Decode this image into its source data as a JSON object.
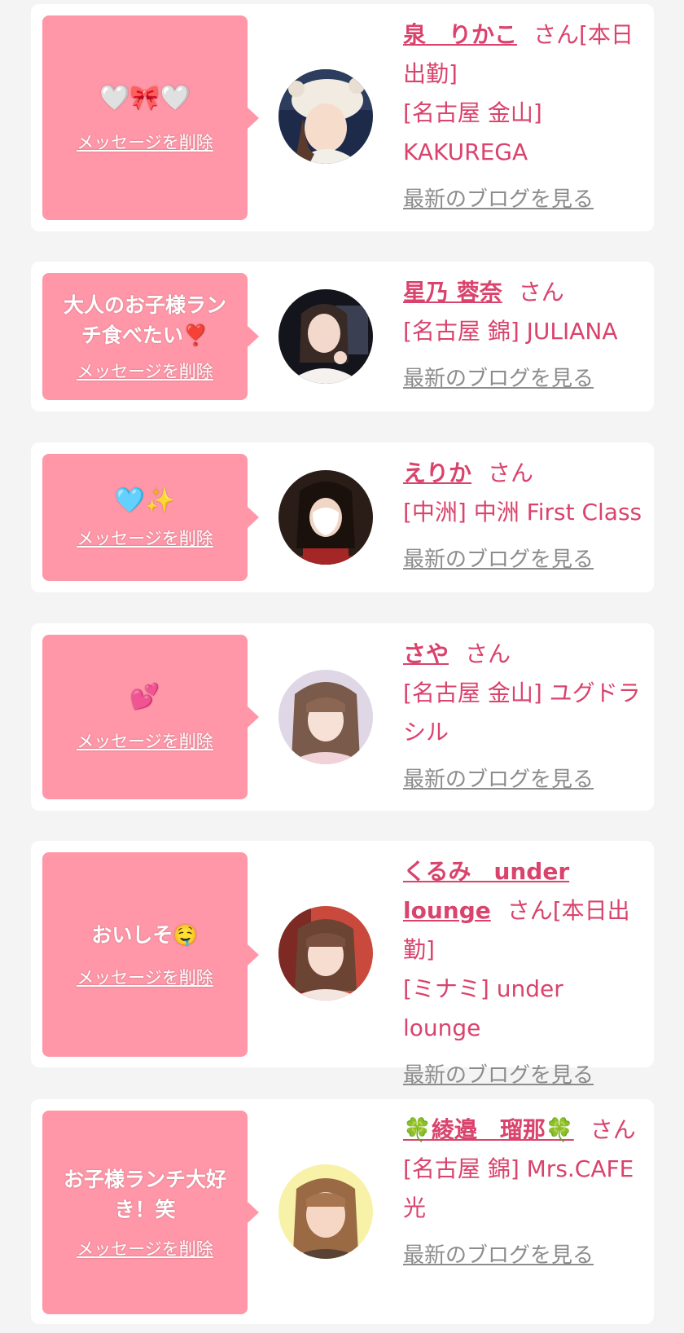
{
  "colors": {
    "background": "#f4f4f4",
    "card": "#ffffff",
    "bubble": "#ff97a8",
    "accent_text": "#d9436c",
    "link_gray": "#8c8c8c"
  },
  "cards": [
    {
      "message": "🤍🎀🤍",
      "delete_label": "メッセージを削除",
      "cast_name": "泉　りかこ",
      "cast_suffix": "さん[本日出勤]",
      "shop": "[名古屋 金山] KAKUREGA",
      "blog_label": "最新のブログを見る",
      "avatar": "avatar-photo"
    },
    {
      "message": "大人のお子様ランチ食べたい❣️",
      "delete_label": "メッセージを削除",
      "cast_name": "星乃 蓉奈",
      "cast_suffix": "さん",
      "shop": "[名古屋 錦] JULIANA",
      "blog_label": "最新のブログを見る",
      "avatar": "avatar-photo"
    },
    {
      "message": "🩵✨",
      "delete_label": "メッセージを削除",
      "cast_name": "えりか",
      "cast_suffix": "さん",
      "shop": "[中洲] 中洲 First Class",
      "blog_label": "最新のブログを見る",
      "avatar": "avatar-photo"
    },
    {
      "message": "💕",
      "delete_label": "メッセージを削除",
      "cast_name": "さや",
      "cast_suffix": "さん",
      "shop": "[名古屋 金山] ユグドラシル",
      "blog_label": "最新のブログを見る",
      "avatar": "avatar-photo"
    },
    {
      "message": "おいしそ🤤",
      "delete_label": "メッセージを削除",
      "cast_name": "くるみ　under lounge",
      "cast_suffix": "さん[本日出勤]",
      "shop": "[ミナミ] under lounge",
      "blog_label": "最新のブログを見る",
      "avatar": "avatar-photo"
    },
    {
      "message": "お子様ランチ大好き！笑",
      "delete_label": "メッセージを削除",
      "cast_name": "🍀綾邉　瑠那🍀",
      "cast_suffix": "さん",
      "shop": "[名古屋 錦] Mrs.CAFE 光",
      "blog_label": "最新のブログを見る",
      "avatar": "avatar-photo"
    }
  ]
}
